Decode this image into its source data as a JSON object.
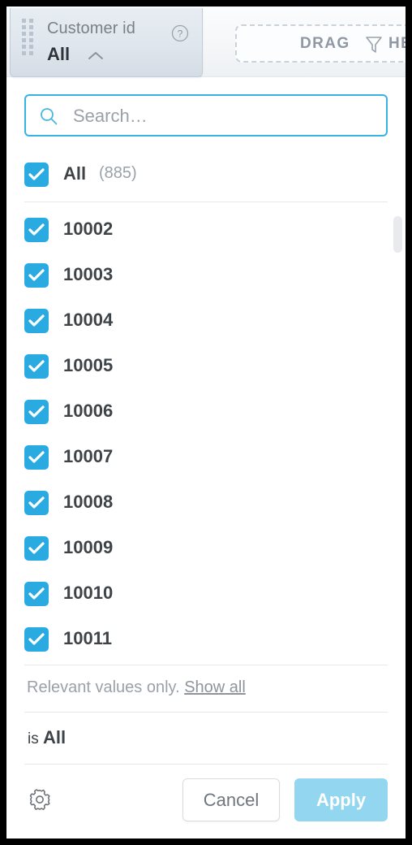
{
  "filter_tile": {
    "title": "Customer id",
    "value": "All",
    "help_icon": "question-mark-circle-icon",
    "drag_handle_icon": "drag-handle-dots-icon",
    "collapse_icon": "chevron-up-icon"
  },
  "dropzone": {
    "label_left": "DRAG",
    "label_right": "HE",
    "icon": "funnel-filter-icon"
  },
  "search": {
    "placeholder": "Search…",
    "value": "",
    "icon": "search-icon"
  },
  "list": {
    "select_all": {
      "label": "All",
      "count": "(885)",
      "checked": true
    },
    "items": [
      {
        "label": "10002",
        "checked": true
      },
      {
        "label": "10003",
        "checked": true
      },
      {
        "label": "10004",
        "checked": true
      },
      {
        "label": "10005",
        "checked": true
      },
      {
        "label": "10006",
        "checked": true
      },
      {
        "label": "10007",
        "checked": true
      },
      {
        "label": "10008",
        "checked": true
      },
      {
        "label": "10009",
        "checked": true
      },
      {
        "label": "10010",
        "checked": true
      },
      {
        "label": "10011",
        "checked": true
      }
    ]
  },
  "relevant": {
    "text": "Relevant values only.",
    "link": "Show all"
  },
  "summary": {
    "prefix": "is",
    "value": "All"
  },
  "footer": {
    "settings_icon": "gear-icon",
    "cancel_label": "Cancel",
    "apply_label": "Apply"
  },
  "colors": {
    "accent": "#29abe2",
    "accent_muted": "#92d6ef",
    "text": "#3d4347",
    "muted_text": "#9aa1a8"
  }
}
